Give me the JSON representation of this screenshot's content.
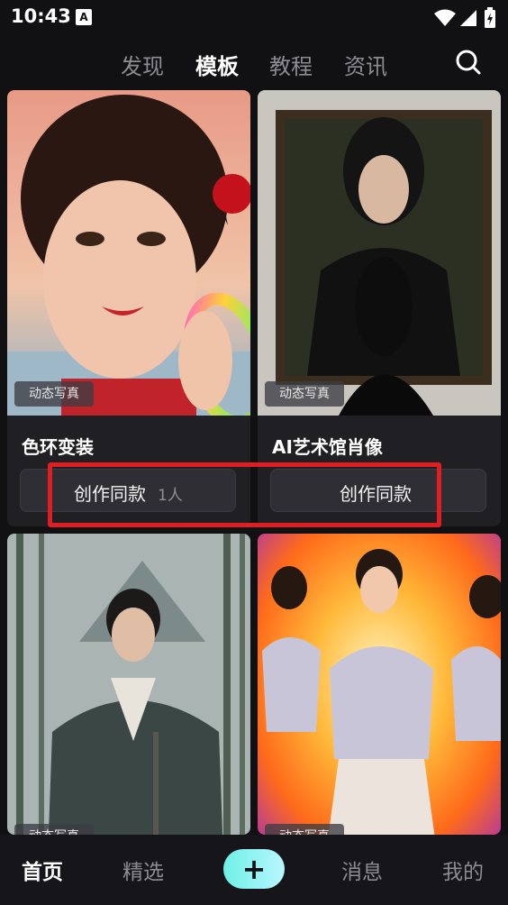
{
  "status": {
    "time": "10:43",
    "app_icon": "A"
  },
  "tabs": [
    {
      "label": "发现"
    },
    {
      "label": "模板"
    },
    {
      "label": "教程"
    },
    {
      "label": "资讯"
    }
  ],
  "cards": [
    {
      "badge": "动态写真",
      "title": "色环变装",
      "button": "创作同款",
      "count": "1人"
    },
    {
      "badge": "动态写真",
      "title": "AI艺术馆肖像",
      "button": "创作同款",
      "count": ""
    },
    {
      "badge": "动态写真"
    },
    {
      "badge": "动态写真"
    }
  ],
  "bottom_nav": {
    "home": "首页",
    "featured": "精选",
    "plus": "+",
    "messages": "消息",
    "me": "我的"
  },
  "colors": {
    "highlight": "#e01d23",
    "accent": "#6ef0e6"
  },
  "icons": [
    "search-icon",
    "wifi-icon",
    "signal-icon",
    "battery-icon",
    "plus-icon"
  ]
}
